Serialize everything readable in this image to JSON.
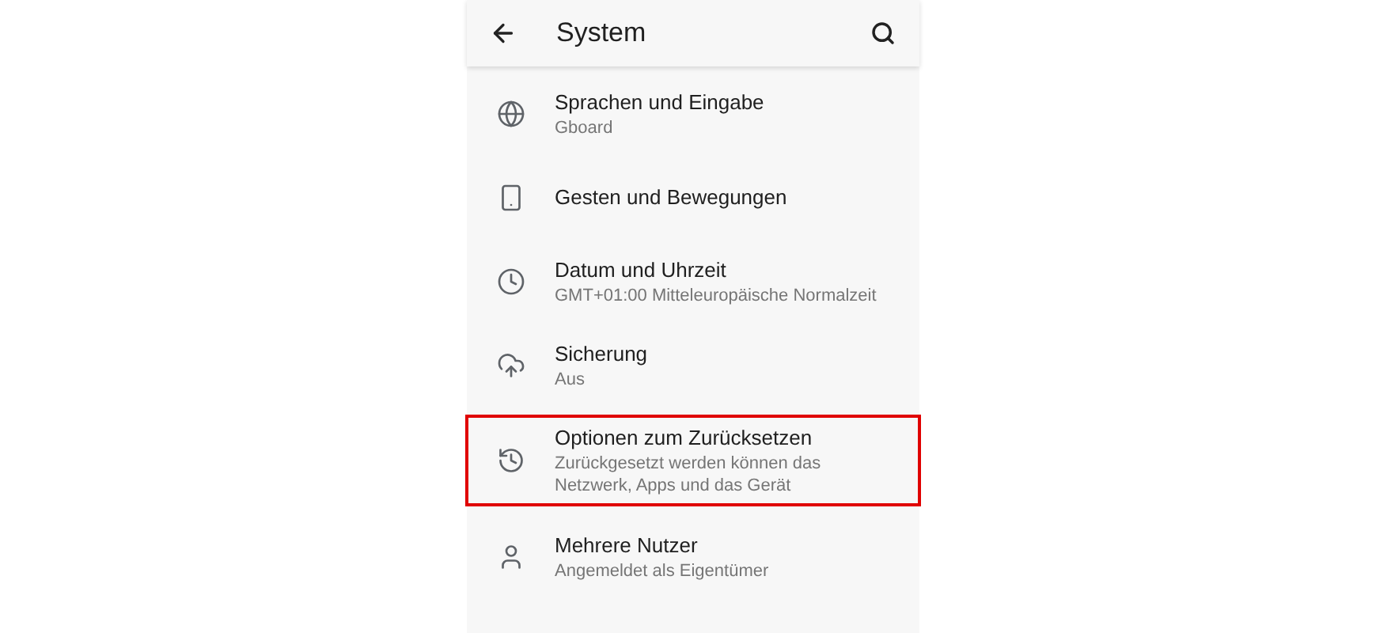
{
  "app_bar": {
    "title": "System"
  },
  "items": [
    {
      "kind": "globe",
      "title": "Sprachen und Eingabe",
      "subtitle": "Gboard",
      "highlighted": false
    },
    {
      "kind": "gesture",
      "title": "Gesten und Bewegungen",
      "highlighted": false
    },
    {
      "kind": "clock",
      "title": "Datum und Uhrzeit",
      "subtitle": "GMT+01:00 Mitteleuropäische Normalzeit",
      "highlighted": false
    },
    {
      "kind": "backup",
      "title": "Sicherung",
      "subtitle": "Aus",
      "highlighted": false
    },
    {
      "kind": "reset",
      "title": "Optionen zum Zurücksetzen",
      "subtitle": "Zurückgesetzt werden können das Netzwerk, Apps und das Gerät",
      "highlighted": true
    },
    {
      "kind": "user",
      "title": "Mehrere Nutzer",
      "subtitle": "Angemeldet als Eigentümer",
      "highlighted": false
    }
  ]
}
